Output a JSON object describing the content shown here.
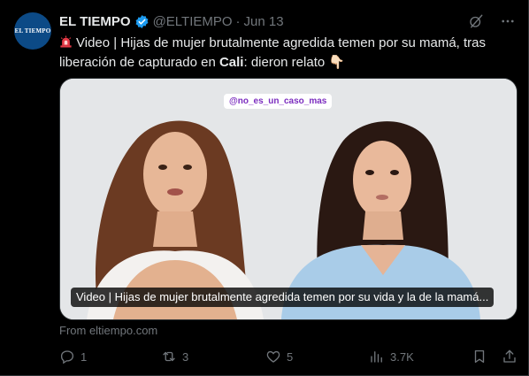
{
  "author": {
    "name": "EL TIEMPO",
    "handle": "@ELTIEMPO",
    "separator": "·",
    "date": "Jun 13",
    "avatar_text": "EL TIEMPO"
  },
  "tweet": {
    "text_part1": "Video | Hijas de mujer brutalmente agredida temen por su mamá, tras liberación de capturado en ",
    "text_bold": "Cali",
    "text_part2": ": dieron relato 👇🏻"
  },
  "media": {
    "tag": "@no_es_un_caso_mas",
    "caption": "Video | Hijas de mujer brutalmente agredida temen por su vida y la de la mamá..."
  },
  "source": "From eltiempo.com",
  "actions": {
    "replies": "1",
    "reposts": "3",
    "likes": "5",
    "views": "3.7K"
  },
  "colors": {
    "background": "#000000",
    "text": "#e7e9ea",
    "muted": "#71767b",
    "verified": "#1d9bf0",
    "avatar_bg": "#0c4a86"
  }
}
